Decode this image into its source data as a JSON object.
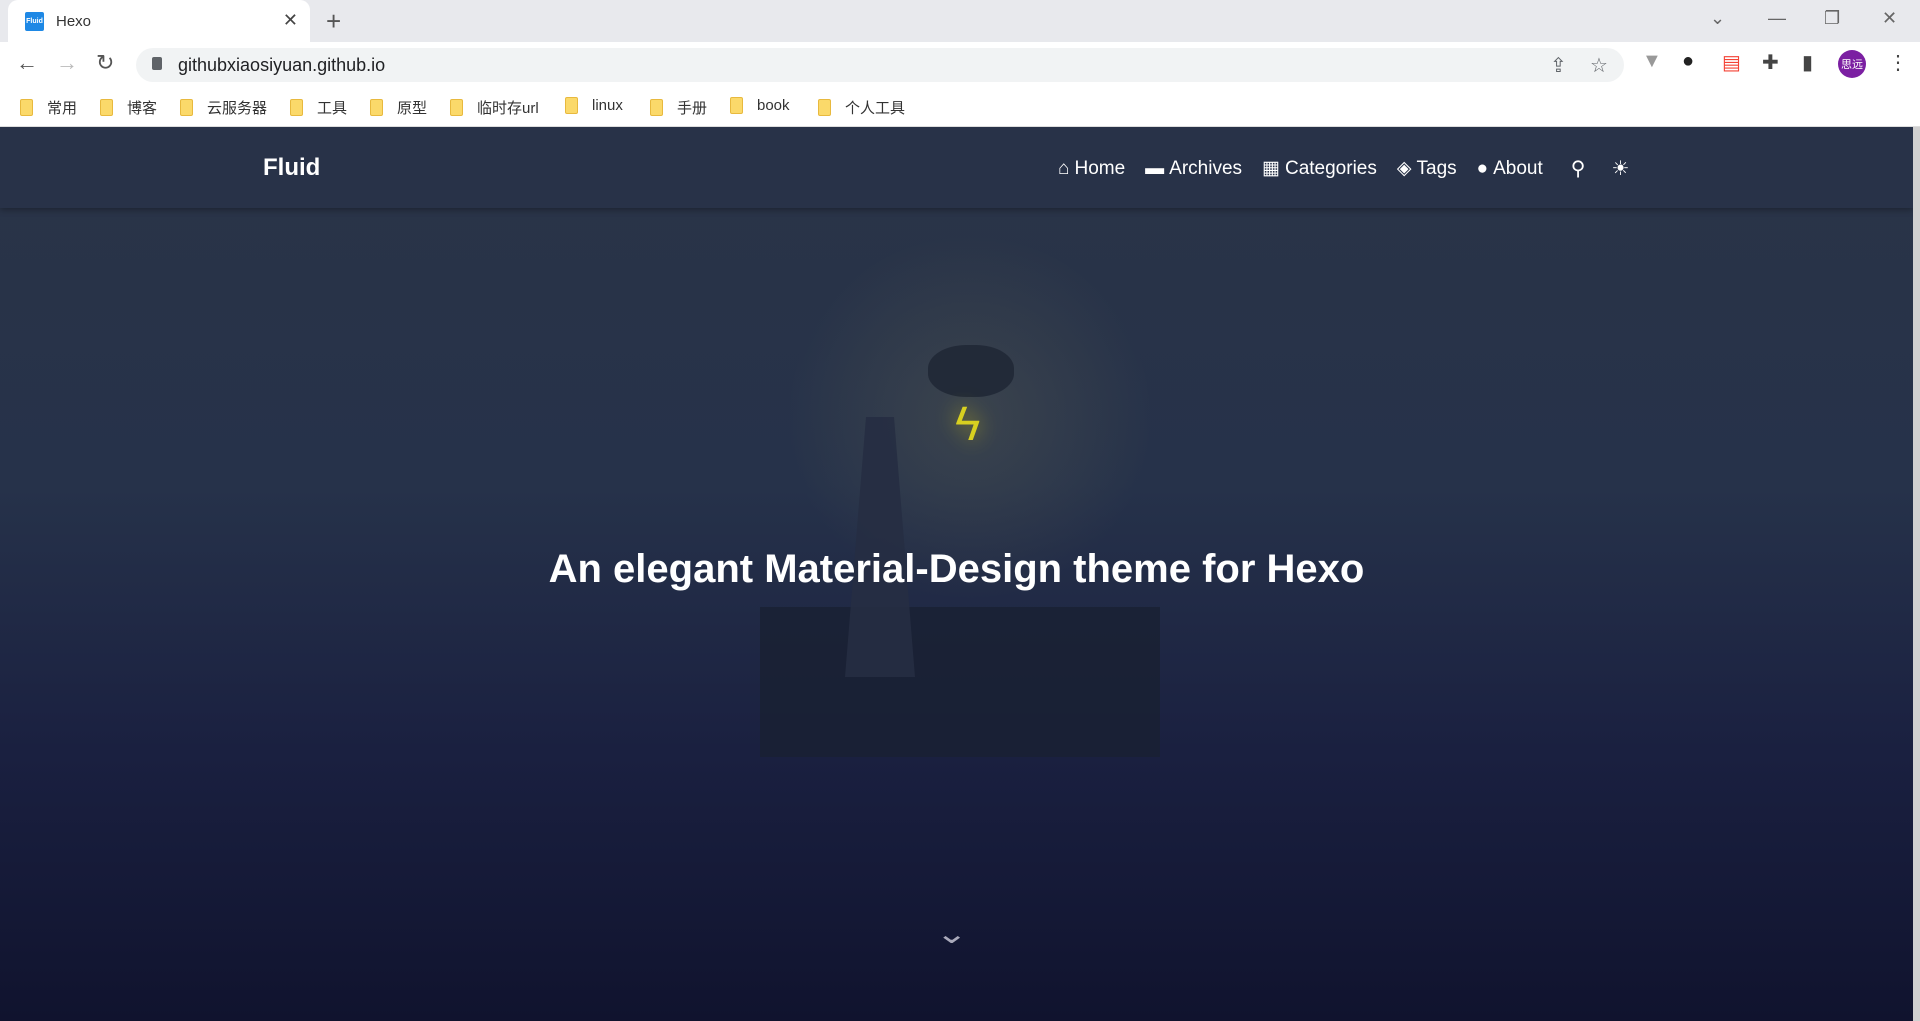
{
  "browser": {
    "tab": {
      "title": "Hexo",
      "favicon_text": "Fluid"
    },
    "url": "githubxiaosiyuan.github.io",
    "profile": "思远",
    "bookmarks": [
      "常用",
      "博客",
      "云服务器",
      "工具",
      "原型",
      "临时存url",
      "linux",
      "手册",
      "book",
      "个人工具"
    ]
  },
  "site": {
    "brand": "Fluid",
    "menu": [
      {
        "icon": "home-icon",
        "glyph": "⌂",
        "label": "Home"
      },
      {
        "icon": "archive-icon",
        "glyph": "▬",
        "label": "Archives"
      },
      {
        "icon": "categories-icon",
        "glyph": "▦",
        "label": "Categories"
      },
      {
        "icon": "tags-icon",
        "glyph": "◈",
        "label": "Tags"
      },
      {
        "icon": "user-icon",
        "glyph": "●",
        "label": "About"
      }
    ],
    "hero_title": "An elegant Material-Design theme for Hexo"
  }
}
